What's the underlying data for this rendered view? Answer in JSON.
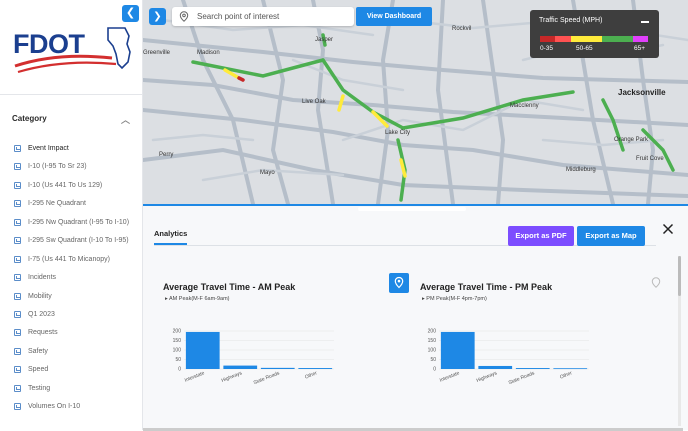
{
  "sidebar": {
    "logo_text": "FDOT",
    "collapse_icon": "chevron-left-icon",
    "category_title": "Category",
    "items": [
      {
        "label": "Event Impact",
        "active": true
      },
      {
        "label": "I-10 (I-95 To Sr 23)"
      },
      {
        "label": "I-10 (Us 441 To Us 129)"
      },
      {
        "label": "I-295 Ne Quadrant"
      },
      {
        "label": "I-295 Nw Quadrant (I-95 To I-10)"
      },
      {
        "label": "I-295 Sw Quadrant (I-10 To I-95)"
      },
      {
        "label": "I-75 (Us 441 To Micanopy)"
      },
      {
        "label": "Incidents"
      },
      {
        "label": "Mobility"
      },
      {
        "label": "Q1 2023"
      },
      {
        "label": "Requests"
      },
      {
        "label": "Safety"
      },
      {
        "label": "Speed"
      },
      {
        "label": "Testing"
      },
      {
        "label": "Volumes On I-10"
      }
    ]
  },
  "map": {
    "search_placeholder": "Search point of interest",
    "view_dashboard_label": "View Dashboard",
    "cities": [
      {
        "name": "Greenville"
      },
      {
        "name": "Madison"
      },
      {
        "name": "Jasper"
      },
      {
        "name": "Live Oak"
      },
      {
        "name": "Lake City"
      },
      {
        "name": "Perry"
      },
      {
        "name": "Mayo"
      },
      {
        "name": "Macclenny"
      },
      {
        "name": "Jacksonville",
        "big": true
      },
      {
        "name": "Orange Park"
      },
      {
        "name": "Fruit Cove"
      },
      {
        "name": "Middleburg"
      },
      {
        "name": "Rockvil"
      }
    ],
    "legend": {
      "title": "Traffic Speed (MPH)",
      "colors": [
        "#c62828",
        "#ff5252",
        "#ffeb3b",
        "#ffeb3b",
        "#4caf50",
        "#4caf50",
        "#e040fb"
      ],
      "labels": [
        "0-35",
        "50-65",
        "65+"
      ]
    }
  },
  "panel": {
    "tab_label": "Analytics",
    "export_pdf_label": "Export as PDF",
    "export_map_label": "Export as Map",
    "cards": [
      {
        "title": "Average Travel Time - AM Peak",
        "subtitle": "AM Peak(M-F 6am-9am)",
        "chart_data": {
          "type": "bar",
          "categories": [
            "Interstate",
            "Highways",
            "State Roads",
            "Other"
          ],
          "values": [
            195,
            18,
            6,
            5
          ],
          "yticks": [
            0,
            50,
            100,
            150,
            200
          ],
          "ylim": [
            0,
            200
          ],
          "color": "#1e88e5"
        }
      },
      {
        "title": "Average Travel Time - PM Peak",
        "subtitle": "PM Peak(M-F 4pm-7pm)",
        "chart_data": {
          "type": "bar",
          "categories": [
            "Interstate",
            "Highways",
            "State Roads",
            "Other"
          ],
          "values": [
            195,
            16,
            5,
            4
          ],
          "yticks": [
            0,
            50,
            100,
            150,
            200
          ],
          "ylim": [
            0,
            200
          ],
          "color": "#1e88e5"
        }
      }
    ]
  }
}
